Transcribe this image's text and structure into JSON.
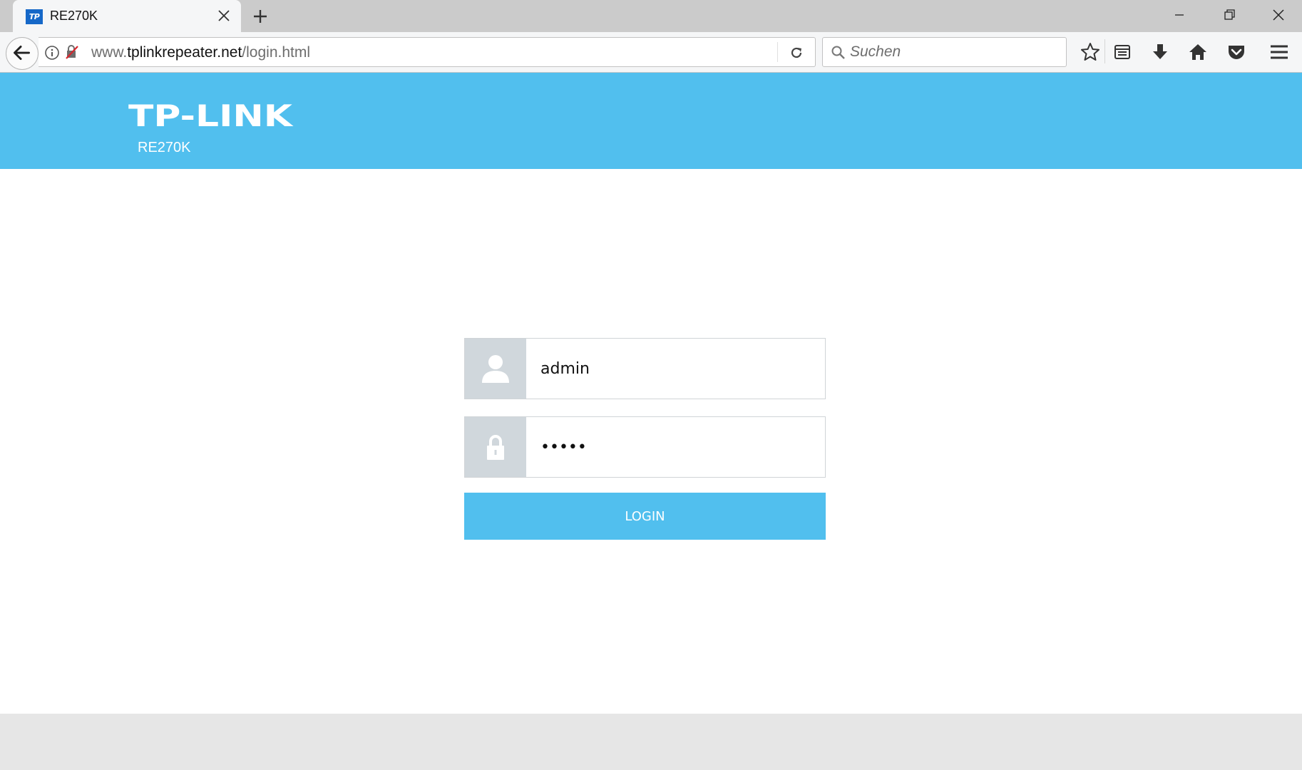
{
  "browser": {
    "tab": {
      "favicon_text": "TP",
      "title": "RE270K"
    },
    "url": {
      "prefix": "www.",
      "domain": "tplinkrepeater.net",
      "path": "/login.html"
    },
    "search": {
      "placeholder": "Suchen"
    },
    "icons": [
      "back-arrow-icon",
      "info-icon",
      "mixed-content-icon",
      "reload-icon",
      "search-icon",
      "star-icon",
      "reading-list-icon",
      "download-icon",
      "home-icon",
      "pocket-icon",
      "hamburger-menu-icon"
    ]
  },
  "header": {
    "logo_text": "TP-LINK",
    "model": "RE270K"
  },
  "login": {
    "username_value": "admin",
    "password_value": "admin",
    "button_label": "LOGIN"
  },
  "colors": {
    "brand": "#51bfee",
    "icon_bg": "#d0d7dc",
    "footer": "#e6e6e6"
  }
}
